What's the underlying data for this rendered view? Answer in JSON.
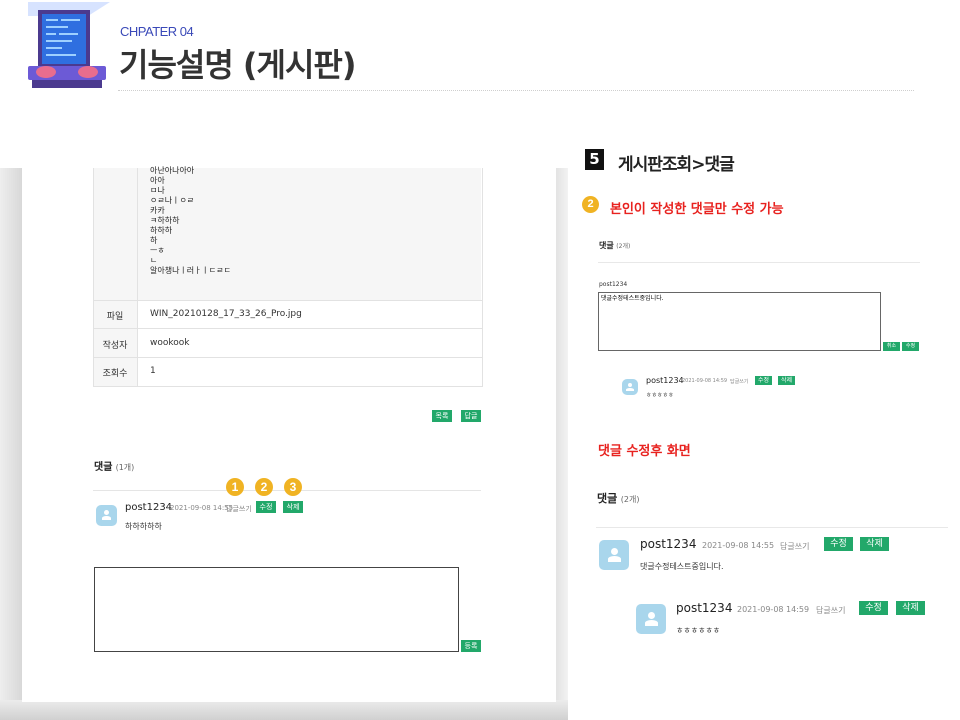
{
  "header": {
    "chapter": "CHPATER 04",
    "title": "기능설명 (게시판)"
  },
  "left_panel": {
    "content_lines": [
      "아난아나아아",
      "아아",
      "ㅁ나",
      "ㅇㄹ나ㅣㅇㄹ",
      "카카",
      "ㅋ하하하",
      "하하하",
      "하",
      "ㅡㅎ",
      "ㄴ",
      "알아챙나ㅣ러ㅏㅣㄷㄹㄷ"
    ],
    "rows": [
      {
        "label": "파일",
        "value": "WIN_20210128_17_33_26_Pro.jpg"
      },
      {
        "label": "작성자",
        "value": "wookook"
      },
      {
        "label": "조회수",
        "value": "1"
      }
    ],
    "list_button": "목록",
    "reply_button": "답글",
    "comments_title": "댓글",
    "comments_count": "(1개)",
    "badges": [
      "1",
      "2",
      "3"
    ],
    "comment": {
      "author": "post1234",
      "date": "2021-09-08 14:55",
      "reply_link": "답글쓰기",
      "edit_button": "수정",
      "delete_button": "삭제",
      "text": "하하하하하"
    },
    "comment_input_value": "",
    "register_button": "등록"
  },
  "right_panel": {
    "step_number": "5",
    "section_title": "게시판조회>댓글",
    "note_number": "2",
    "note": "본인이 작성한 댓글만 수정 가능",
    "edit_view": {
      "comments_title": "댓글",
      "comments_count": "(2개)",
      "author": "post1234",
      "textarea_value": "댓글수정테스트중입니다.",
      "cancel_button": "취소",
      "edit_button": "수정",
      "reply": {
        "author": "post1234",
        "date": "2021-09-08 14:59",
        "reply_link": "답글쓰기",
        "edit_button": "수정",
        "delete_button": "삭제",
        "text": "ㅎㅎㅎㅎㅎ"
      }
    },
    "after_title": "댓글 수정후 화면",
    "after_view": {
      "comments_title": "댓글",
      "comments_count": "(2개)",
      "comment": {
        "author": "post1234",
        "date": "2021-09-08 14:55",
        "reply_link": "답글쓰기",
        "edit_button": "수정",
        "delete_button": "삭제",
        "text": "댓글수정테스트중입니다."
      },
      "reply": {
        "author": "post1234",
        "date": "2021-09-08 14:59",
        "reply_link": "답글쓰기",
        "edit_button": "수정",
        "delete_button": "삭제",
        "text": "ㅎㅎㅎㅎㅎㅎ"
      }
    }
  },
  "colors": {
    "accent_green": "#22a86a",
    "badge_orange": "#f0b323",
    "heading_red": "#e8221f",
    "chapter_blue": "#3a49b8"
  }
}
